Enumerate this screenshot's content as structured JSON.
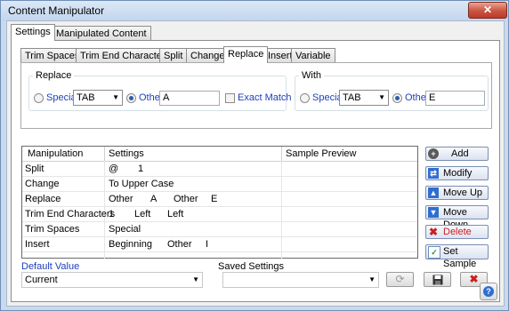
{
  "window": {
    "title": "Content Manipulator",
    "close_glyph": "✕"
  },
  "top_tabs": [
    {
      "label": "Settings"
    },
    {
      "label": "Manipulated Content"
    }
  ],
  "sub_tabs": [
    {
      "label": "Trim Spaces"
    },
    {
      "label": "Trim End Characters"
    },
    {
      "label": "Split"
    },
    {
      "label": "Change"
    },
    {
      "label": "Replace"
    },
    {
      "label": "Insert"
    },
    {
      "label": "Variable"
    }
  ],
  "replace_group": {
    "title": "Replace",
    "special_label": "Special",
    "special_value": "TAB",
    "other_label": "Other",
    "other_value": "A",
    "exact_match_label": "Exact Match",
    "selected": "other"
  },
  "with_group": {
    "title": "With",
    "special_label": "Special",
    "special_value": "TAB",
    "other_label": "Other",
    "other_value": "E",
    "selected": "other"
  },
  "table": {
    "columns": [
      "Manipulation",
      "Settings",
      "Sample Preview"
    ],
    "rows": [
      {
        "manipulation": "Split",
        "settings": [
          "@",
          "1",
          ""
        ],
        "preview": ""
      },
      {
        "manipulation": "Change",
        "settings": [
          "To Upper Case",
          "",
          ""
        ],
        "preview": ""
      },
      {
        "manipulation": "Replace",
        "settings": [
          "Other",
          "A",
          "Other",
          "E"
        ],
        "preview": ""
      },
      {
        "manipulation": "Trim End Characters",
        "settings": [
          "1",
          "Left",
          "Left"
        ],
        "preview": ""
      },
      {
        "manipulation": "Trim Spaces",
        "settings": [
          "Special",
          "",
          ""
        ],
        "preview": ""
      },
      {
        "manipulation": "Insert",
        "settings": [
          "Beginning",
          "Other",
          "I"
        ],
        "preview": ""
      }
    ]
  },
  "action_buttons": [
    {
      "label": "Add",
      "icon": "plus-icon",
      "color": "#5a5a5a",
      "glyph": "+"
    },
    {
      "label": "Modify",
      "icon": "modify-arrows-icon",
      "color": "#2f6ed1",
      "glyph": "⇄"
    },
    {
      "label": "Move Up",
      "icon": "arrow-up-icon",
      "color": "#2f6ed1",
      "glyph": "▲"
    },
    {
      "label": "Move Down",
      "icon": "arrow-down-icon",
      "color": "#2f6ed1",
      "glyph": "▼"
    },
    {
      "label": "Delete",
      "icon": "delete-x-icon",
      "color": "#cc1f1f",
      "glyph": "✖"
    },
    {
      "label": "Set Sample",
      "icon": "set-sample-icon",
      "color": "#3c8a3c",
      "glyph": "✓"
    }
  ],
  "default_value": {
    "label": "Default Value",
    "value": "Current"
  },
  "saved_settings": {
    "label": "Saved Settings",
    "value": ""
  },
  "saved_buttons": {
    "refresh_glyph": "⟳",
    "save_glyph": "💾",
    "delete_glyph": "✖"
  },
  "help": {
    "glyph": "?"
  },
  "colors": {
    "accent_blue": "#1d3fbd",
    "delete_red": "#cc1f1f"
  }
}
